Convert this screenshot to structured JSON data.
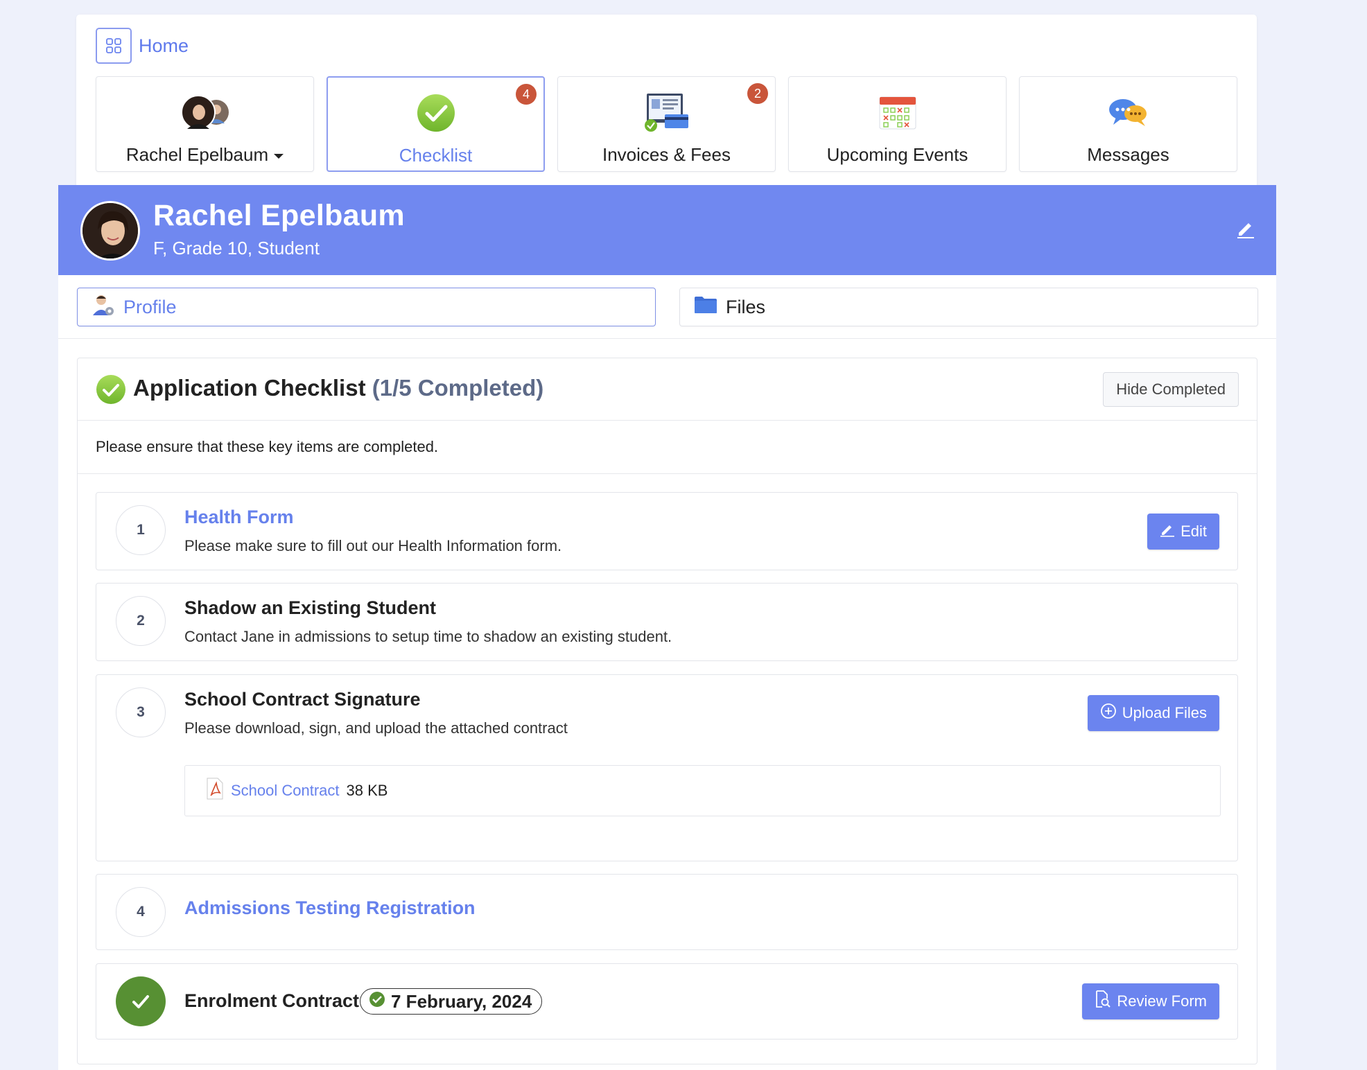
{
  "nav": {
    "home_label": "Home",
    "tiles": [
      {
        "label": "Rachel Epelbaum",
        "icon": "student-avatars-icon",
        "dropdown": true
      },
      {
        "label": "Checklist",
        "icon": "checkmark-icon",
        "badge": "4",
        "active": true
      },
      {
        "label": "Invoices & Fees",
        "icon": "invoice-icon",
        "badge": "2"
      },
      {
        "label": "Upcoming Events",
        "icon": "calendar-icon"
      },
      {
        "label": "Messages",
        "icon": "chat-bubbles-icon"
      }
    ]
  },
  "student": {
    "name": "Rachel Epelbaum",
    "subtitle": "F, Grade 10, Student"
  },
  "subtabs": [
    {
      "label": "Profile",
      "icon": "profile-icon",
      "active": true
    },
    {
      "label": "Files",
      "icon": "folder-icon"
    }
  ],
  "checklist": {
    "title": "Application Checklist",
    "count": "(1/5 Completed)",
    "hide_button": "Hide Completed",
    "intro": "Please ensure that these key items are completed.",
    "items": [
      {
        "number": "1",
        "title": "Health Form",
        "description": "Please make sure to fill out our Health Information form.",
        "button": "Edit"
      },
      {
        "number": "2",
        "title": "Shadow an Existing Student",
        "description": "Contact Jane in admissions to setup time to shadow an existing student."
      },
      {
        "number": "3",
        "title": "School Contract Signature",
        "description": "Please download, sign, and upload the attached contract",
        "button": "Upload Files",
        "attachment": {
          "name": "School Contract",
          "size": "38 KB"
        }
      },
      {
        "number": "4",
        "title": "Admissions Testing Registration"
      },
      {
        "title": "Enrolment Contract",
        "completed_date": "7 February, 2024",
        "button": "Review Form"
      }
    ]
  },
  "colors": {
    "accent": "#6b84ef",
    "banner": "#7088f0",
    "badge": "#c9553a",
    "success": "#579033",
    "page_bg": "#eef1fb"
  }
}
